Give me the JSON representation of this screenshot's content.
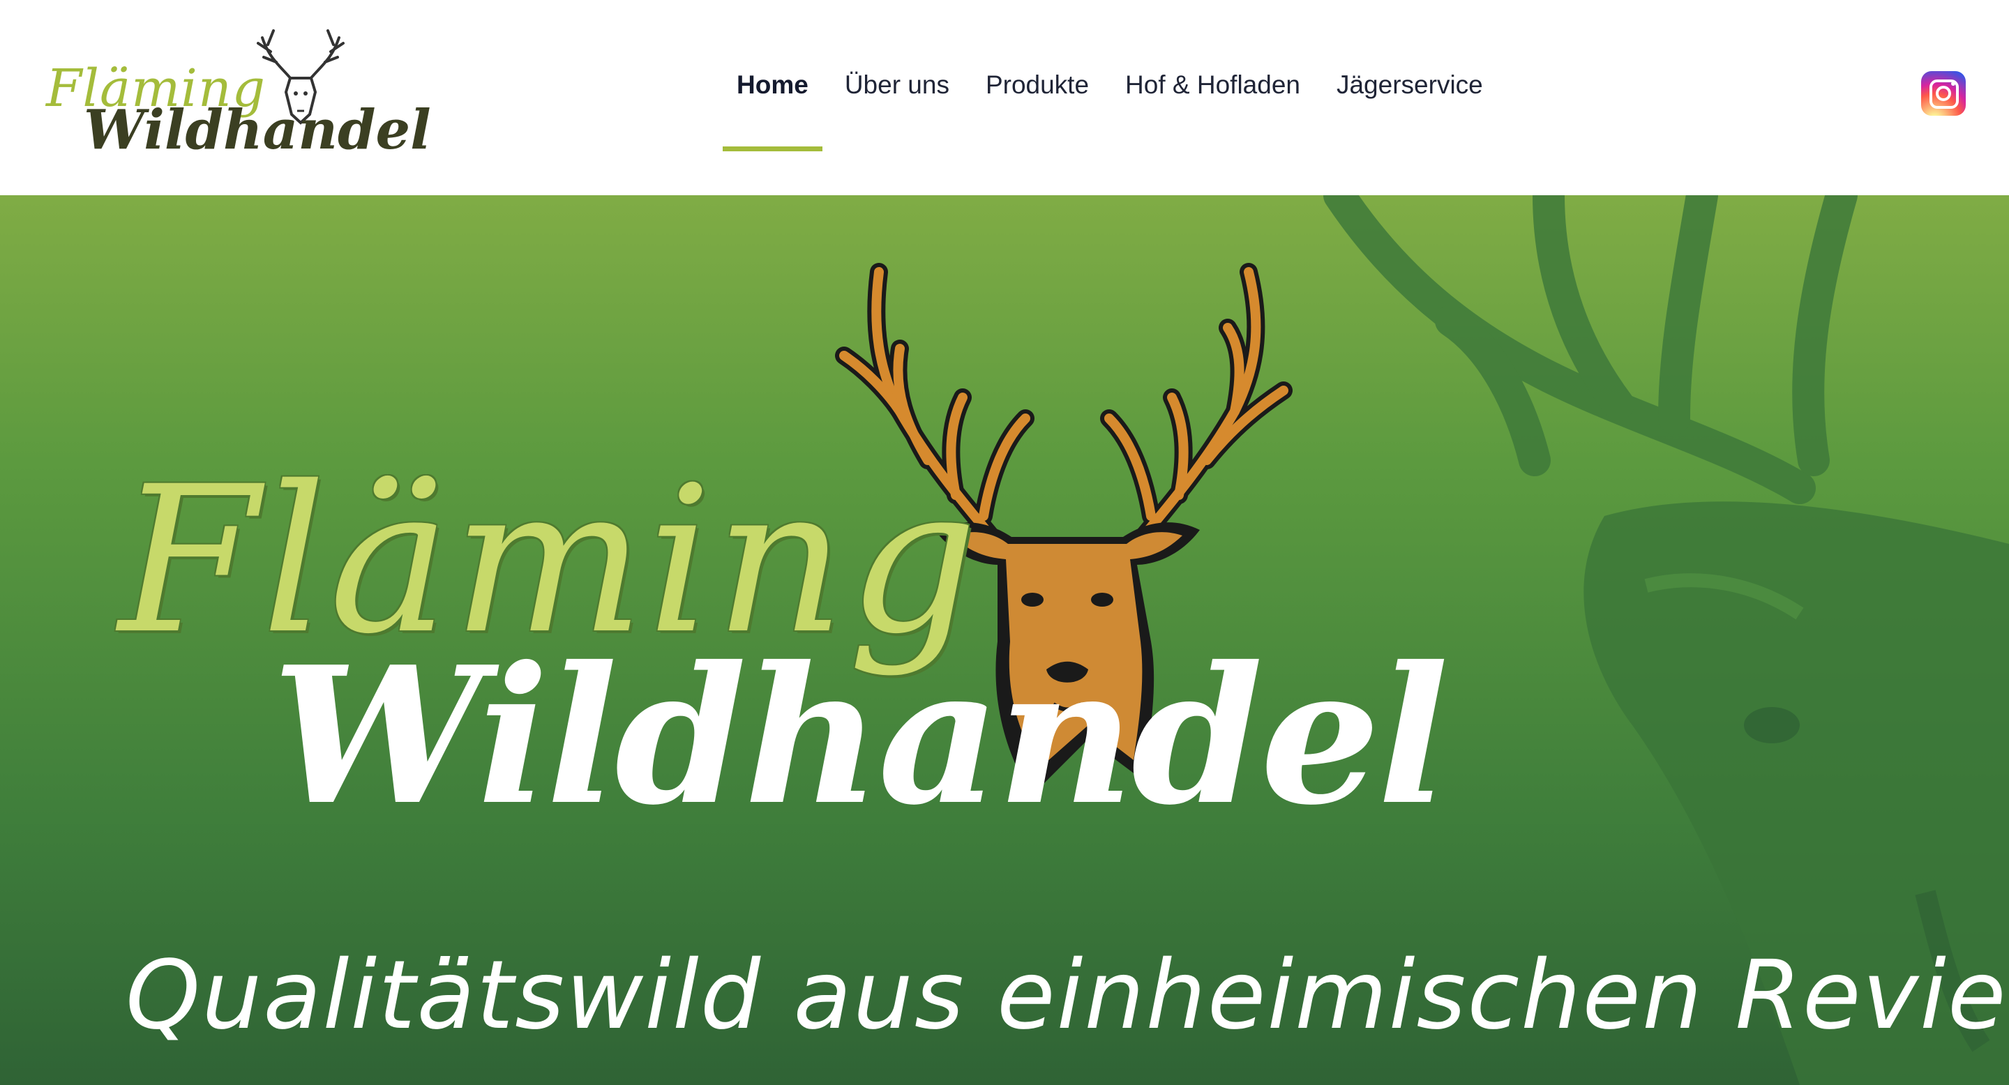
{
  "brand": {
    "logo_line_1": "Fläming",
    "logo_line_2": "Wildhandel"
  },
  "nav": {
    "items": [
      {
        "label": "Home",
        "active": true
      },
      {
        "label": "Über uns",
        "active": false
      },
      {
        "label": "Produkte",
        "active": false
      },
      {
        "label": "Hof & Hofladen",
        "active": false
      },
      {
        "label": "Jägerservice",
        "active": false
      }
    ]
  },
  "social": {
    "icon": "instagram-icon"
  },
  "hero": {
    "title_line_1": "Fläming",
    "title_line_2": "Wildhandel",
    "tagline": "Qualitätswild aus einheimischen Revieren"
  },
  "colors": {
    "accent_green": "#a4bc3b",
    "hero_green_top": "#80ac45",
    "hero_green_bottom": "#2f6335",
    "nav_text": "#1f2436"
  }
}
